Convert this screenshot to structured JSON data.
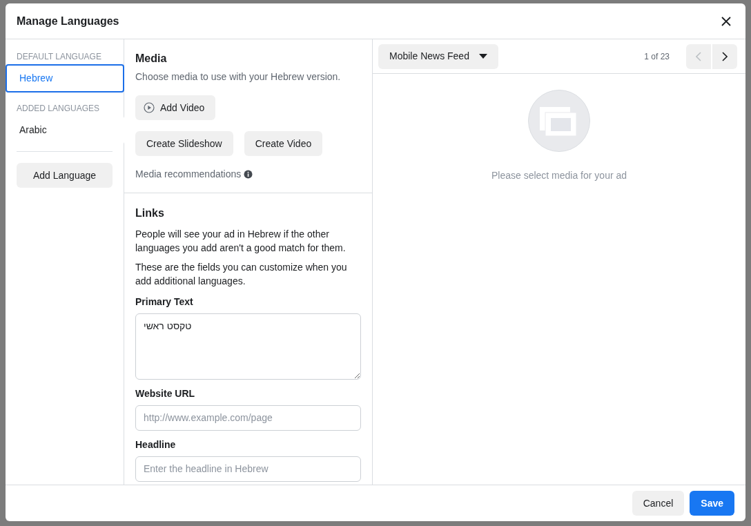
{
  "dialog": {
    "title": "Manage Languages"
  },
  "languages": {
    "default_heading": "DEFAULT LANGUAGE",
    "default": [
      {
        "name": "Hebrew",
        "selected": true
      }
    ],
    "added_heading": "ADDED LANGUAGES",
    "added": [
      {
        "name": "Arabic",
        "selected": false
      }
    ],
    "add_button": "Add Language"
  },
  "media": {
    "title": "Media",
    "description": "Choose media to use with your Hebrew version.",
    "add_video": "Add Video",
    "buttons": [
      "Create Slideshow",
      "Create Video"
    ],
    "recommendations": "Media recommendations"
  },
  "links": {
    "title": "Links",
    "paragraphs": [
      "People will see your ad in Hebrew if the other languages you add aren't a good match for them.",
      "These are the fields you can customize when you add additional languages."
    ],
    "fields": [
      {
        "kind": "textarea",
        "label": "Primary Text",
        "value": "טקסט ראשי"
      },
      {
        "kind": "input",
        "label": "Website URL",
        "placeholder": "http://www.example.com/page"
      },
      {
        "kind": "input",
        "label": "Headline",
        "placeholder": "Enter the headline in Hebrew"
      }
    ]
  },
  "preview": {
    "placement": "Mobile News Feed",
    "pager": "1 of 23",
    "prev_disabled": true,
    "next_disabled": false,
    "empty_message": "Please select media for your ad"
  },
  "footer": {
    "buttons": [
      {
        "label": "Cancel",
        "kind": "secondary"
      },
      {
        "label": "Save",
        "kind": "primary"
      }
    ]
  }
}
